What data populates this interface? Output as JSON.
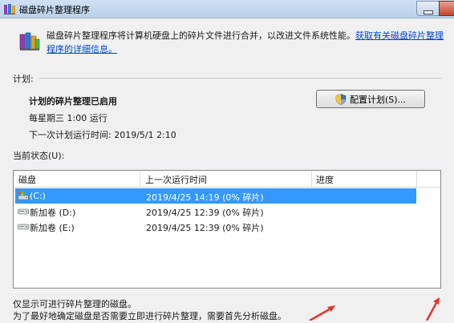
{
  "window": {
    "title": "磁盘碎片整理程序"
  },
  "intro": {
    "text": "磁盘碎片整理程序将计算机硬盘上的碎片文件进行合并，以改进文件系统性能。",
    "link": "获取有关磁盘碎片整理程序的详细信息。"
  },
  "schedule": {
    "section_label": "计划:",
    "status": "计划的碎片整理已启用",
    "frequency": "每星期三  1:00 运行",
    "next_run": "下一次计划运行时间: 2019/5/1 2:10",
    "configure_button": "配置计划(S)..."
  },
  "current_status": {
    "label": "当前状态(U):",
    "columns": [
      "磁盘",
      "上一次运行时间",
      "进度"
    ],
    "rows": [
      {
        "disk": "(C:)",
        "last_run": "2019/4/25 14:19 (0% 碎片)",
        "progress": "",
        "selected": true
      },
      {
        "disk": "新加卷 (D:)",
        "last_run": "2019/4/25 12:39 (0% 碎片)",
        "progress": "",
        "selected": false
      },
      {
        "disk": "新加卷 (E:)",
        "last_run": "2019/4/25 12:39 (0% 碎片)",
        "progress": "",
        "selected": false
      }
    ]
  },
  "footer": {
    "line1": "仅显示可进行碎片整理的磁盘。",
    "line2": "为了最好地确定磁盘是否需要立即进行碎片整理，需要首先分析磁盘。"
  },
  "colors": {
    "selection": "#3399ff",
    "link": "#0046d5",
    "annotation_arrow": "#e8342a"
  },
  "icons": {
    "title": "defrag-app-icon",
    "app": "defrag-app-icon",
    "button": "uac-shield-icon",
    "system_drive": "system-drive-icon",
    "drive": "hard-drive-icon"
  }
}
